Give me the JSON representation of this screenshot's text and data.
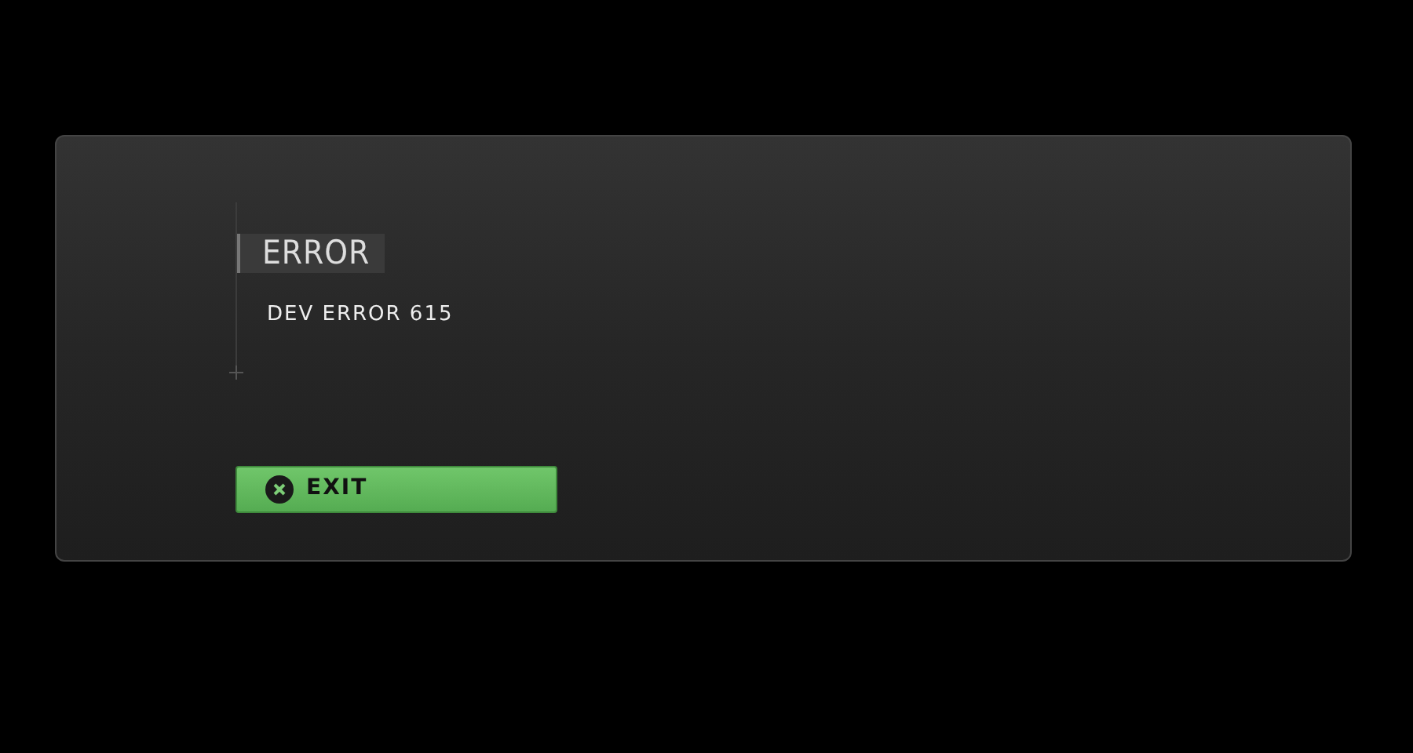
{
  "dialog": {
    "title": "ERROR",
    "message": "DEV ERROR 615",
    "buttons": [
      {
        "label": "EXIT",
        "kind": "primary"
      }
    ]
  }
}
